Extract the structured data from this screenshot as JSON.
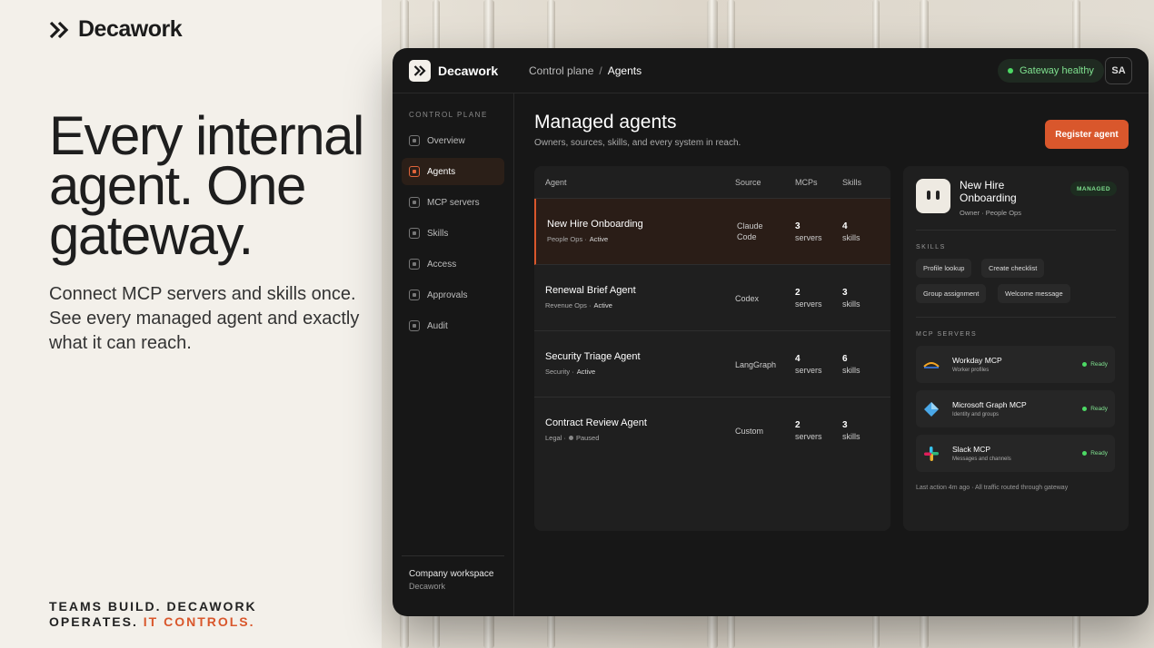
{
  "brand": {
    "name": "Decawork"
  },
  "hero": {
    "headline": "Every internal agent. One gateway.",
    "subline": "Connect MCP servers and skills once. See every managed agent and exactly what it can reach.",
    "tagline_main": "TEAMS BUILD. DECAWORK OPERATES. ",
    "tagline_accent": "IT CONTROLS."
  },
  "colors": {
    "accent": "#d9572c",
    "status_green": "#4cd964",
    "app_bg": "#171717"
  },
  "app": {
    "name": "Decawork",
    "breadcrumb": {
      "root": "Control plane",
      "separator": "/",
      "current": "Agents"
    },
    "gateway_status": "Gateway healthy",
    "user_initials": "SA",
    "sidebar": {
      "section_label": "CONTROL PLANE",
      "items": [
        {
          "label": "Overview"
        },
        {
          "label": "Agents",
          "active": true
        },
        {
          "label": "MCP servers"
        },
        {
          "label": "Skills"
        },
        {
          "label": "Access"
        },
        {
          "label": "Approvals"
        },
        {
          "label": "Audit"
        }
      ],
      "workspace_name": "Company workspace",
      "workspace_org": "Decawork"
    },
    "main": {
      "title": "Managed agents",
      "subtitle": "Owners, sources, skills, and every system in reach.",
      "register_button": "Register agent"
    },
    "table": {
      "columns": [
        "Agent",
        "Source",
        "MCPs",
        "Skills"
      ],
      "rows": [
        {
          "name": "New Hire Onboarding",
          "team": "People Ops ·",
          "status": "Active",
          "source": "Claude Code",
          "mcps": "3",
          "mcps_unit": "servers",
          "skills": "4",
          "skills_unit": "skills",
          "selected": true
        },
        {
          "name": "Renewal Brief Agent",
          "team": "Revenue Ops ·",
          "status": "Active",
          "source": "Codex",
          "mcps": "2",
          "mcps_unit": "servers",
          "skills": "3",
          "skills_unit": "skills"
        },
        {
          "name": "Security Triage Agent",
          "team": "Security ·",
          "status": "Active",
          "source": "LangGraph",
          "mcps": "4",
          "mcps_unit": "servers",
          "skills": "6",
          "skills_unit": "skills"
        },
        {
          "name": "Contract Review Agent",
          "team": "Legal ·",
          "status": "Paused",
          "source": "Custom",
          "mcps": "2",
          "mcps_unit": "servers",
          "skills": "3",
          "skills_unit": "skills"
        }
      ]
    },
    "detail": {
      "name": "New Hire Onboarding",
      "owner": "Owner · People Ops",
      "badge": "MANAGED",
      "skills_label": "SKILLS",
      "skills": [
        "Profile lookup",
        "Create checklist",
        "Group assignment",
        "Welcome message"
      ],
      "mcp_label": "MCP SERVERS",
      "mcp_servers": [
        {
          "name": "Workday MCP",
          "desc": "Worker profiles",
          "status": "Ready",
          "icon": "workday-icon"
        },
        {
          "name": "Microsoft Graph MCP",
          "desc": "Identity and groups",
          "status": "Ready",
          "icon": "microsoft-graph-icon"
        },
        {
          "name": "Slack MCP",
          "desc": "Messages and channels",
          "status": "Ready",
          "icon": "slack-icon"
        }
      ],
      "footer": "Last action 4m ago · All traffic routed through gateway"
    }
  }
}
